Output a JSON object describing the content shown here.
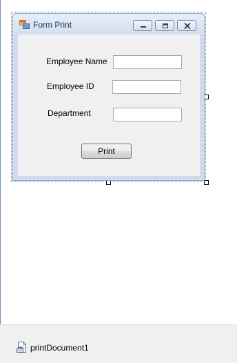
{
  "window": {
    "title": "Form Print"
  },
  "title_buttons": [
    {
      "name": "minimize",
      "icon": "minimize-icon"
    },
    {
      "name": "maximize",
      "icon": "maximize-icon"
    },
    {
      "name": "close",
      "icon": "close-icon"
    }
  ],
  "form": {
    "fields": [
      {
        "label": "Employee Name",
        "value": ""
      },
      {
        "label": "Employee ID",
        "value": ""
      },
      {
        "label": "Department",
        "value": ""
      }
    ],
    "print_button": "Print"
  },
  "component_tray": {
    "items": [
      {
        "label": "printDocument1",
        "icon": "print-document-icon"
      }
    ]
  },
  "colors": {
    "titlebar": "#dce7f5",
    "client": "#f0f0f0",
    "tray": "#f0f0f0"
  }
}
